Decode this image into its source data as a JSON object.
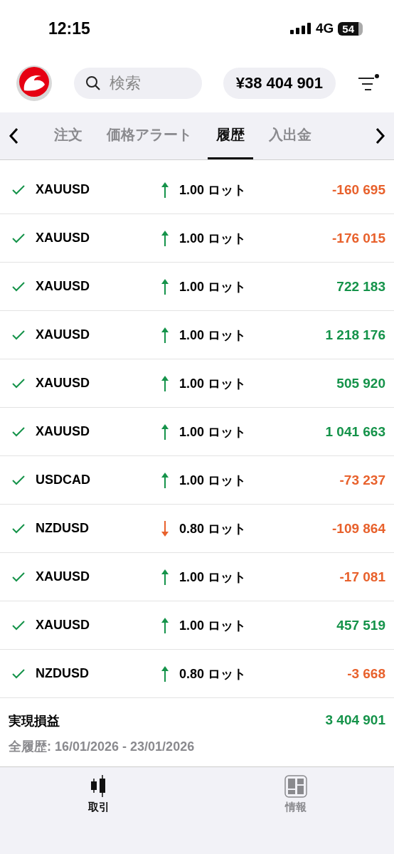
{
  "status_bar": {
    "time": "12:15",
    "network": "4G",
    "battery": "54"
  },
  "header": {
    "search": {
      "placeholder": "検索"
    },
    "balance": "¥38 404 901",
    "filter_badge": true
  },
  "tabs": [
    {
      "label": "注文",
      "selected": false
    },
    {
      "label": "価格アラート",
      "selected": false
    },
    {
      "label": "履歴",
      "selected": true
    },
    {
      "label": "入出金",
      "selected": false
    }
  ],
  "trades": [
    {
      "symbol": "XAUUSD",
      "buy": true,
      "volume": "1.00 ロット",
      "profit": "-160 695",
      "color": "#e8612c"
    },
    {
      "symbol": "XAUUSD",
      "buy": true,
      "volume": "1.00 ロット",
      "profit": "-176 015",
      "color": "#e8612c"
    },
    {
      "symbol": "XAUUSD",
      "buy": true,
      "volume": "1.00 ロット",
      "profit": "722 183",
      "color": "#15934a"
    },
    {
      "symbol": "XAUUSD",
      "buy": true,
      "volume": "1.00 ロット",
      "profit": "1 218 176",
      "color": "#15934a"
    },
    {
      "symbol": "XAUUSD",
      "buy": true,
      "volume": "1.00 ロット",
      "profit": "505 920",
      "color": "#15934a"
    },
    {
      "symbol": "XAUUSD",
      "buy": true,
      "volume": "1.00 ロット",
      "profit": "1 041 663",
      "color": "#15934a"
    },
    {
      "symbol": "USDCAD",
      "buy": true,
      "volume": "1.00 ロット",
      "profit": "-73 237",
      "color": "#e8612c"
    },
    {
      "symbol": "NZDUSD",
      "buy": false,
      "volume": "0.80 ロット",
      "profit": "-109 864",
      "color": "#e8612c"
    },
    {
      "symbol": "XAUUSD",
      "buy": true,
      "volume": "1.00 ロット",
      "profit": "-17 081",
      "color": "#e8612c"
    },
    {
      "symbol": "XAUUSD",
      "buy": true,
      "volume": "1.00 ロット",
      "profit": "457 519",
      "color": "#15934a"
    },
    {
      "symbol": "NZDUSD",
      "buy": true,
      "volume": "0.80 ロット",
      "profit": "-3 668",
      "color": "#e8612c"
    }
  ],
  "summary": {
    "label": "実現損益",
    "total": "3 404 901",
    "period": "全履歴: 16/01/2026 - 23/01/2026"
  },
  "bottom_nav": [
    {
      "label": "取引",
      "kind": "trade",
      "selected": true
    },
    {
      "label": "情報",
      "kind": "info",
      "selected": false
    }
  ]
}
